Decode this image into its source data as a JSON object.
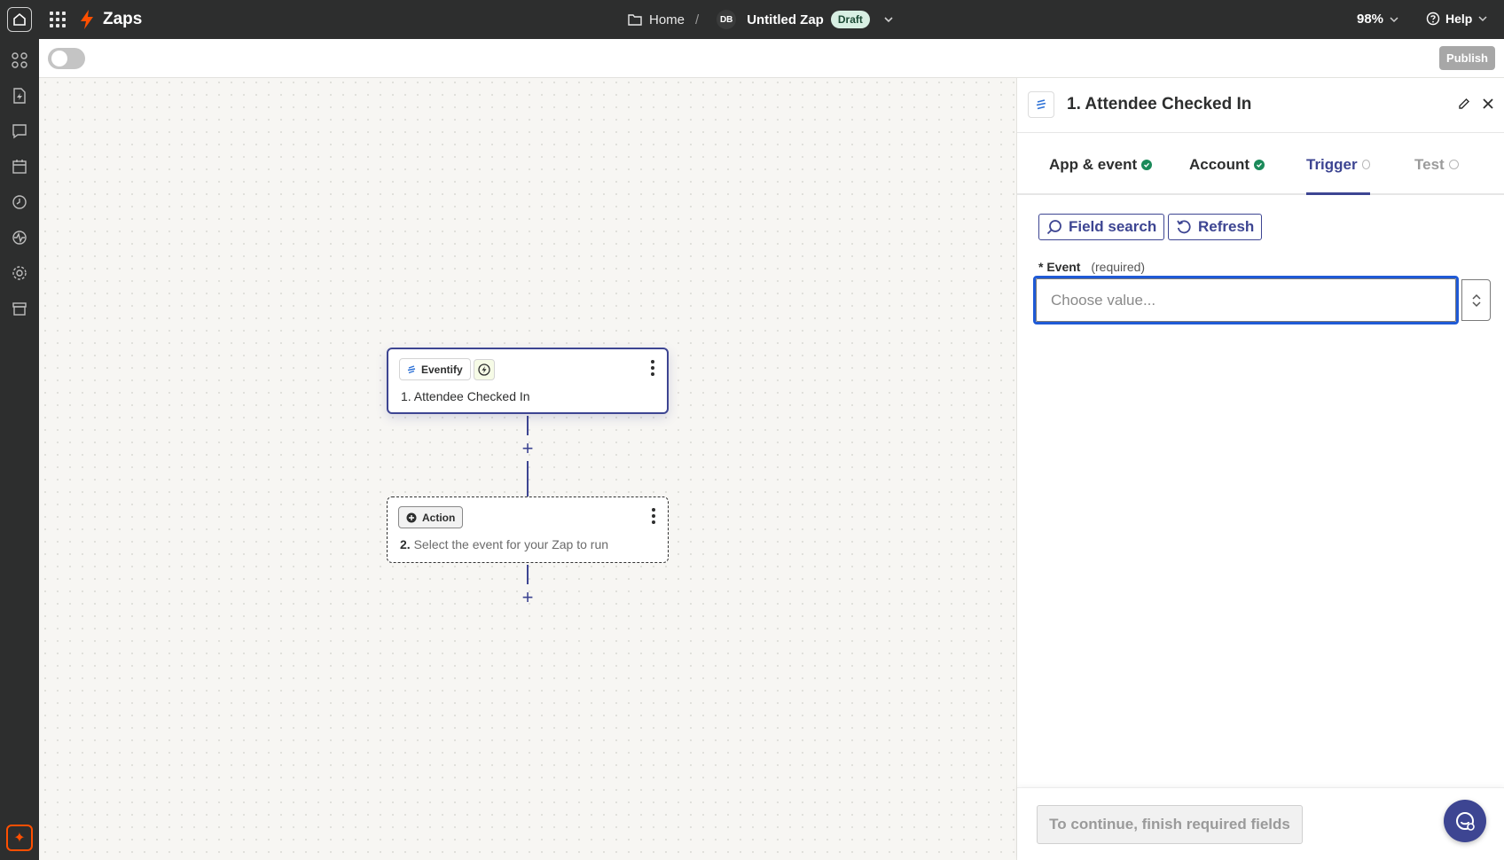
{
  "topbar": {
    "brand": "Zaps",
    "breadcrumb_home": "Home",
    "breadcrumb_sep": "/",
    "avatar_initials": "DB",
    "zap_name": "Untitled Zap",
    "status_badge": "Draft",
    "zoom": "98%",
    "help": "Help"
  },
  "toolbar": {
    "publish_label": "Publish"
  },
  "canvas": {
    "trigger_step": {
      "app_name": "Eventify",
      "title": "1. Attendee Checked In"
    },
    "action_step": {
      "chip_label": "Action",
      "number": "2.",
      "title": "Select the event for your Zap to run"
    },
    "add_step_symbol": "+"
  },
  "panel": {
    "title": "1. Attendee Checked In",
    "tabs": [
      {
        "label": "App & event",
        "state": "complete"
      },
      {
        "label": "Account",
        "state": "complete"
      },
      {
        "label": "Trigger",
        "state": "active"
      },
      {
        "label": "Test",
        "state": "disabled"
      }
    ],
    "field_search_label": "Field search",
    "refresh_label": "Refresh",
    "event_field": {
      "asterisk": "*",
      "label": "Event",
      "required_text": "(required)",
      "placeholder": "Choose value..."
    },
    "continue_label": "To continue, finish required fields"
  },
  "colors": {
    "accent": "#3d4592",
    "focus_blue": "#1f5ad6",
    "brand_orange": "#ff4f00",
    "success_green": "#1b8a5a",
    "topbar_dark": "#2d2e2e"
  },
  "icons": {
    "rail": [
      "apps-icon",
      "zap-file-icon",
      "chat-icon",
      "calendar-icon",
      "history-icon",
      "activity-icon",
      "settings-icon",
      "archive-icon"
    ],
    "bottom_rail": "copilot-sparkle-icon"
  }
}
